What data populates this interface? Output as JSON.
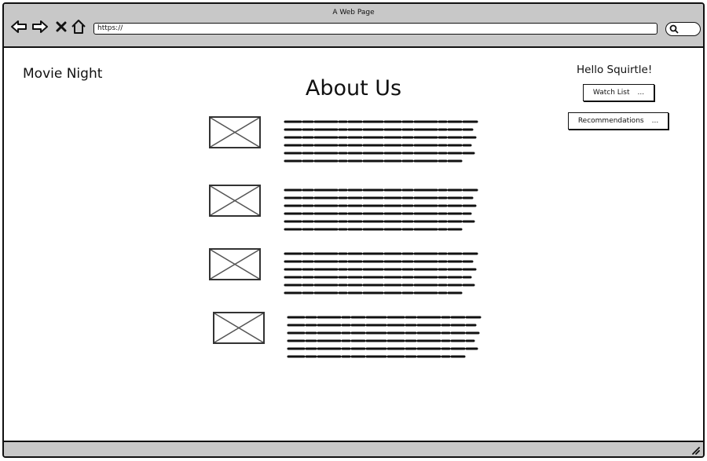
{
  "window": {
    "title": "A Web Page"
  },
  "browser": {
    "url": "https://"
  },
  "header": {
    "site_name": "Movie Night",
    "page_title": "About Us",
    "greeting": "Hello Squirtle!"
  },
  "buttons": {
    "watch_list": {
      "label": "Watch List",
      "suffix": "..."
    },
    "recommendations": {
      "label": "Recommendations",
      "suffix": "..."
    }
  },
  "icons": {
    "back": "arrow-left-icon",
    "forward": "arrow-right-icon",
    "stop": "close-icon",
    "home": "home-icon",
    "search": "search-icon",
    "resize": "resize-grip-icon",
    "thumbnail": "image-placeholder-icon"
  },
  "content": {
    "item_count": 4
  }
}
